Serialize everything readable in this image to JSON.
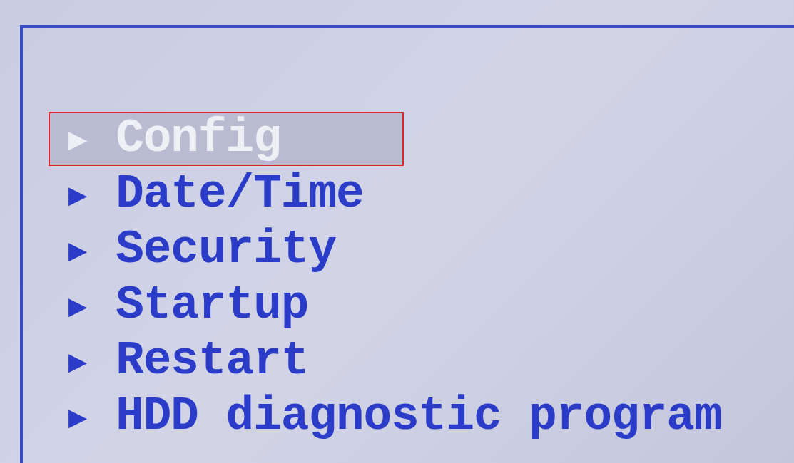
{
  "menu": {
    "items": [
      {
        "marker": "▶",
        "label": "Config",
        "selected": true
      },
      {
        "marker": "▶",
        "label": "Date/Time",
        "selected": false
      },
      {
        "marker": "▶",
        "label": "Security",
        "selected": false
      },
      {
        "marker": "▶",
        "label": "Startup",
        "selected": false
      },
      {
        "marker": "▶",
        "label": "Restart",
        "selected": false
      },
      {
        "marker": "▶",
        "label": "HDD diagnostic program",
        "selected": false
      }
    ]
  }
}
